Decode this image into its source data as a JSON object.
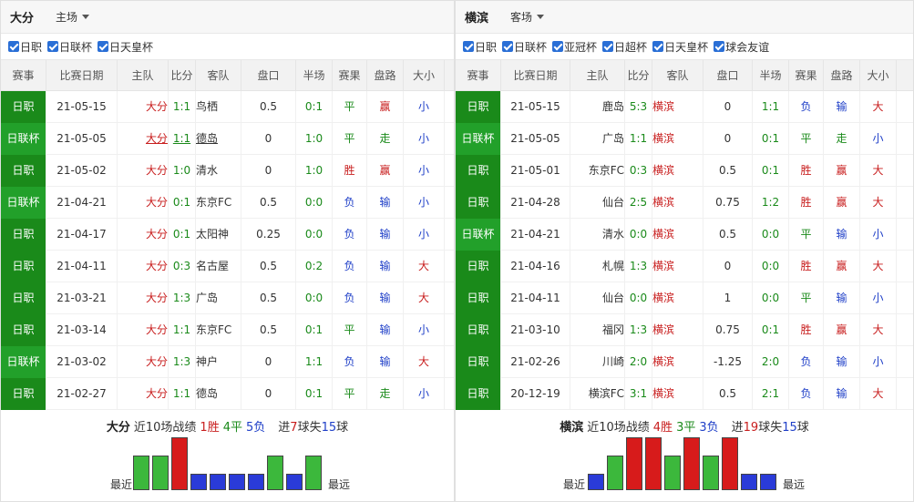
{
  "left": {
    "title": "大分",
    "venue": "主场",
    "filters": [
      "日职",
      "日联杯",
      "日天皇杯"
    ],
    "headers": [
      "赛事",
      "比赛日期",
      "主队",
      "比分",
      "客队",
      "盘口",
      "半场",
      "赛果",
      "盘路",
      "大小"
    ],
    "rows": [
      {
        "comp": "日职",
        "date": "21-05-15",
        "home": "大分",
        "score": "1:1",
        "away": "鸟栖",
        "pk": "0.5",
        "half": "0:1",
        "res": "平",
        "pan": "赢",
        "bs": "小"
      },
      {
        "comp": "日联杯",
        "date": "21-05-05",
        "home": "大分",
        "score": "1:1",
        "away": "德岛",
        "pk": "0",
        "half": "1:0",
        "res": "平",
        "pan": "走",
        "bs": "小"
      },
      {
        "comp": "日职",
        "date": "21-05-02",
        "home": "大分",
        "score": "1:0",
        "away": "清水",
        "pk": "0",
        "half": "1:0",
        "res": "胜",
        "pan": "赢",
        "bs": "小"
      },
      {
        "comp": "日联杯",
        "date": "21-04-21",
        "home": "大分",
        "score": "0:1",
        "away": "东京FC",
        "pk": "0.5",
        "half": "0:0",
        "res": "负",
        "pan": "输",
        "bs": "小"
      },
      {
        "comp": "日职",
        "date": "21-04-17",
        "home": "大分",
        "score": "0:1",
        "away": "太阳神",
        "pk": "0.25",
        "half": "0:0",
        "res": "负",
        "pan": "输",
        "bs": "小"
      },
      {
        "comp": "日职",
        "date": "21-04-11",
        "home": "大分",
        "score": "0:3",
        "away": "名古屋",
        "pk": "0.5",
        "half": "0:2",
        "res": "负",
        "pan": "输",
        "bs": "大"
      },
      {
        "comp": "日职",
        "date": "21-03-21",
        "home": "大分",
        "score": "1:3",
        "away": "广岛",
        "pk": "0.5",
        "half": "0:0",
        "res": "负",
        "pan": "输",
        "bs": "大"
      },
      {
        "comp": "日职",
        "date": "21-03-14",
        "home": "大分",
        "score": "1:1",
        "away": "东京FC",
        "pk": "0.5",
        "half": "0:1",
        "res": "平",
        "pan": "输",
        "bs": "小"
      },
      {
        "comp": "日联杯",
        "date": "21-03-02",
        "home": "大分",
        "score": "1:3",
        "away": "神户",
        "pk": "0",
        "half": "1:1",
        "res": "负",
        "pan": "输",
        "bs": "大"
      },
      {
        "comp": "日职",
        "date": "21-02-27",
        "home": "大分",
        "score": "1:1",
        "away": "德岛",
        "pk": "0",
        "half": "0:1",
        "res": "平",
        "pan": "走",
        "bs": "小"
      }
    ],
    "summary": {
      "team": "大分",
      "label": "近10场战绩",
      "win": "1胜",
      "draw": "4平",
      "loss": "5负",
      "goals_in_pre": "进",
      "goals_in": "7",
      "goals_mid": "球失",
      "goals_out": "15",
      "goals_suf": "球"
    },
    "recent_label": "最近",
    "far_label": "最远",
    "form": [
      "d",
      "d",
      "w",
      "l",
      "l",
      "l",
      "l",
      "d",
      "l",
      "d"
    ]
  },
  "right": {
    "title": "横滨",
    "venue": "客场",
    "filters": [
      "日职",
      "日联杯",
      "亚冠杯",
      "日超杯",
      "日天皇杯",
      "球会友谊"
    ],
    "headers": [
      "赛事",
      "比赛日期",
      "主队",
      "比分",
      "客队",
      "盘口",
      "半场",
      "赛果",
      "盘路",
      "大小"
    ],
    "rows": [
      {
        "comp": "日职",
        "date": "21-05-15",
        "home": "鹿岛",
        "score": "5:3",
        "away": "横滨",
        "pk": "0",
        "half": "1:1",
        "res": "负",
        "pan": "输",
        "bs": "大"
      },
      {
        "comp": "日联杯",
        "date": "21-05-05",
        "home": "广岛",
        "score": "1:1",
        "away": "横滨",
        "pk": "0",
        "half": "0:1",
        "res": "平",
        "pan": "走",
        "bs": "小"
      },
      {
        "comp": "日职",
        "date": "21-05-01",
        "home": "东京FC",
        "score": "0:3",
        "away": "横滨",
        "pk": "0.5",
        "half": "0:1",
        "res": "胜",
        "pan": "赢",
        "bs": "大"
      },
      {
        "comp": "日职",
        "date": "21-04-28",
        "home": "仙台",
        "score": "2:5",
        "away": "横滨",
        "pk": "0.75",
        "half": "1:2",
        "res": "胜",
        "pan": "赢",
        "bs": "大"
      },
      {
        "comp": "日联杯",
        "date": "21-04-21",
        "home": "清水",
        "score": "0:0",
        "away": "横滨",
        "pk": "0.5",
        "half": "0:0",
        "res": "平",
        "pan": "输",
        "bs": "小"
      },
      {
        "comp": "日职",
        "date": "21-04-16",
        "home": "札幌",
        "score": "1:3",
        "away": "横滨",
        "pk": "0",
        "half": "0:0",
        "res": "胜",
        "pan": "赢",
        "bs": "大"
      },
      {
        "comp": "日职",
        "date": "21-04-11",
        "home": "仙台",
        "score": "0:0",
        "away": "横滨",
        "pk": "1",
        "half": "0:0",
        "res": "平",
        "pan": "输",
        "bs": "小"
      },
      {
        "comp": "日职",
        "date": "21-03-10",
        "home": "福冈",
        "score": "1:3",
        "away": "横滨",
        "pk": "0.75",
        "half": "0:1",
        "res": "胜",
        "pan": "赢",
        "bs": "大"
      },
      {
        "comp": "日职",
        "date": "21-02-26",
        "home": "川崎",
        "score": "2:0",
        "away": "横滨",
        "pk": "-1.25",
        "half": "2:0",
        "res": "负",
        "pan": "输",
        "bs": "小"
      },
      {
        "comp": "日职",
        "date": "20-12-19",
        "home": "横滨FC",
        "score": "3:1",
        "away": "横滨",
        "pk": "0.5",
        "half": "2:1",
        "res": "负",
        "pan": "输",
        "bs": "大"
      }
    ],
    "summary": {
      "team": "横滨",
      "label": "近10场战绩",
      "win": "4胜",
      "draw": "3平",
      "loss": "3负",
      "goals_in_pre": "进",
      "goals_in": "19",
      "goals_mid": "球失",
      "goals_out": "15",
      "goals_suf": "球"
    },
    "recent_label": "最近",
    "far_label": "最远",
    "form": [
      "l",
      "d",
      "w",
      "w",
      "d",
      "w",
      "d",
      "w",
      "l",
      "l"
    ]
  }
}
